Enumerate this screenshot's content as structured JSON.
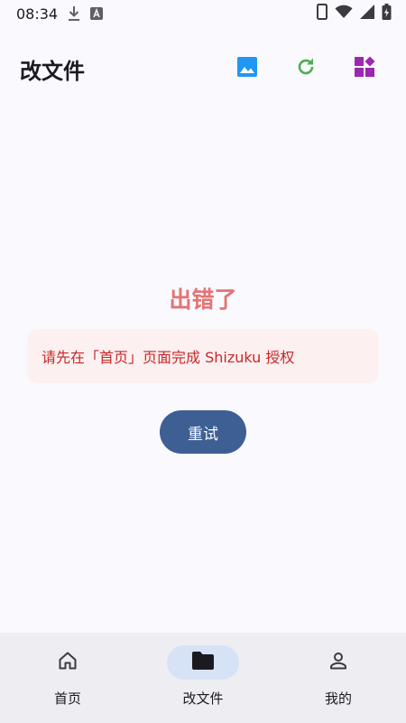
{
  "status_bar": {
    "time": "08:34",
    "icons": [
      "download-icon",
      "a-app-icon",
      "phone-icon",
      "wifi-icon",
      "signal-icon",
      "battery-charging-icon"
    ]
  },
  "app_bar": {
    "title": "改文件",
    "actions": [
      "image-icon",
      "refresh-icon",
      "widgets-icon"
    ]
  },
  "error": {
    "title": "出错了",
    "message": "请先在「首页」页面完成 Shizuku 授权",
    "retry_label": "重试"
  },
  "bottom_nav": {
    "items": [
      {
        "label": "首页",
        "icon": "home-icon",
        "active": false
      },
      {
        "label": "改文件",
        "icon": "folder-icon",
        "active": true
      },
      {
        "label": "我的",
        "icon": "person-icon",
        "active": false
      }
    ]
  },
  "colors": {
    "background": "#faf9fe",
    "error_title": "#e57373",
    "error_card": "#fdf0f0",
    "error_text": "#c62828",
    "primary_button": "#3d5f94",
    "nav_background": "#eeedf2",
    "nav_active_pill": "#d6e3f7",
    "image_icon": "#2196f3",
    "refresh_icon": "#4caf50",
    "widgets_icon": "#9c27b0"
  }
}
